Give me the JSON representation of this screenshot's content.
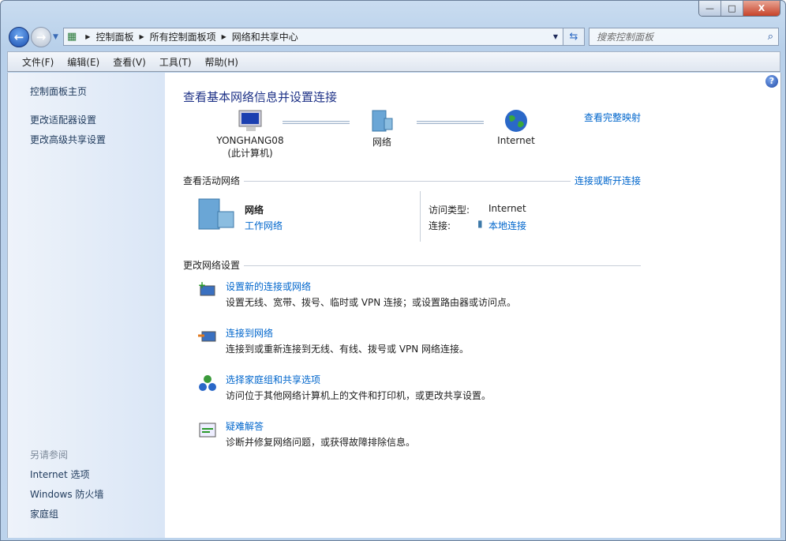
{
  "window": {
    "minimize": "—",
    "maximize": "□",
    "close": "X"
  },
  "address": {
    "crumbs": [
      "控制面板",
      "所有控制面板项",
      "网络和共享中心"
    ]
  },
  "search": {
    "placeholder": "搜索控制面板"
  },
  "menu": [
    "文件(F)",
    "编辑(E)",
    "查看(V)",
    "工具(T)",
    "帮助(H)"
  ],
  "sidebar": {
    "home": "控制面板主页",
    "links": [
      "更改适配器设置",
      "更改高级共享设置"
    ],
    "see_also": "另请参阅",
    "see_also_links": [
      "Internet 选项",
      "Windows 防火墙",
      "家庭组"
    ]
  },
  "main": {
    "title": "查看基本网络信息并设置连接",
    "full_map": "查看完整映射",
    "map": {
      "computer": "YONGHANG08",
      "computer_sub": "(此计算机)",
      "network": "网络",
      "internet": "Internet"
    },
    "active_header": "查看活动网络",
    "connect_disconnect": "连接或断开连接",
    "active": {
      "name": "网络",
      "type": "工作网络",
      "access_label": "访问类型:",
      "access_value": "Internet",
      "conn_label": "连接:",
      "conn_value": "本地连接"
    },
    "change_header": "更改网络设置",
    "tasks": [
      {
        "title": "设置新的连接或网络",
        "desc": "设置无线、宽带、拨号、临时或 VPN 连接；或设置路由器或访问点。"
      },
      {
        "title": "连接到网络",
        "desc": "连接到或重新连接到无线、有线、拨号或 VPN 网络连接。"
      },
      {
        "title": "选择家庭组和共享选项",
        "desc": "访问位于其他网络计算机上的文件和打印机，或更改共享设置。"
      },
      {
        "title": "疑难解答",
        "desc": "诊断并修复网络问题，或获得故障排除信息。"
      }
    ]
  }
}
